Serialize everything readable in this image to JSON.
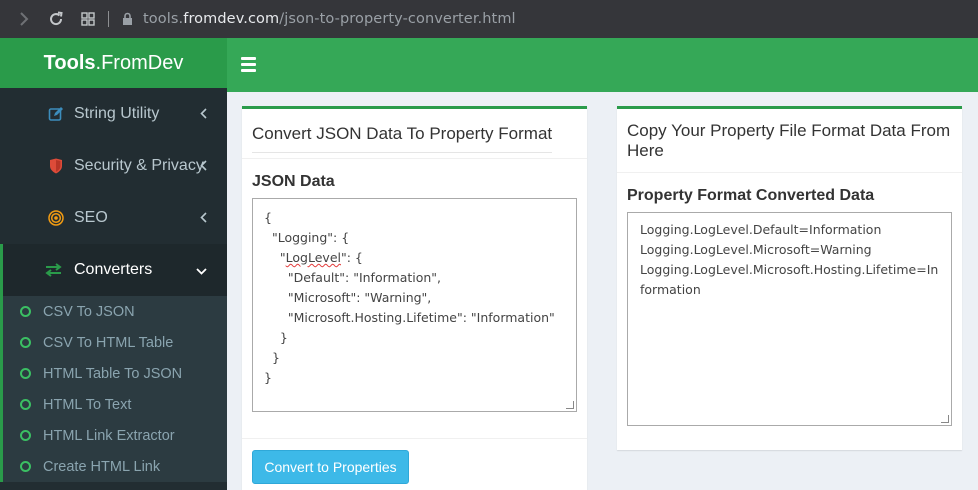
{
  "browser": {
    "url_prefix": "tools.",
    "url_host": "fromdev.com",
    "url_path": "/json-to-property-converter.html"
  },
  "brand": {
    "bold": "Tools",
    "rest": ".FromDev"
  },
  "sidebar": {
    "items": [
      {
        "label": "String Utility",
        "icon": "edit-icon",
        "color": "#3c8dbc"
      },
      {
        "label": "Security & Privacy",
        "icon": "shield-icon",
        "color": "#dd4b39"
      },
      {
        "label": "SEO",
        "icon": "target-icon",
        "color": "#f39c12"
      },
      {
        "label": "Converters",
        "icon": "exchange-icon",
        "color": "#2a9b4a"
      }
    ],
    "submenu": [
      "CSV To JSON",
      "CSV To HTML Table",
      "HTML Table To JSON",
      "HTML To Text",
      "HTML Link Extractor",
      "Create HTML Link"
    ]
  },
  "left_box": {
    "title": "Convert JSON Data To Property Format",
    "label": "JSON Data",
    "json_lines": [
      "{",
      "  \"Logging\": {",
      "    \"LogLevel\": {",
      "      \"Default\": \"Information\",",
      "      \"Microsoft\": \"Warning\",",
      "      \"Microsoft.Hosting.Lifetime\": \"Information\"",
      "    }",
      "  }",
      "}"
    ],
    "button": "Convert to Properties"
  },
  "right_box": {
    "title": "Copy Your Property File Format Data From Here",
    "label": "Property Format Converted Data",
    "output_lines": [
      "Logging.LogLevel.Default=Information",
      "Logging.LogLevel.Microsoft=Warning",
      "Logging.LogLevel.Microsoft.Hosting.Lifetime=In",
      "formation"
    ]
  },
  "colors": {
    "brand_green": "#2a9b4a",
    "header_green": "#35a857",
    "sidebar_bg": "#222d32",
    "button_blue": "#3db9e8"
  }
}
